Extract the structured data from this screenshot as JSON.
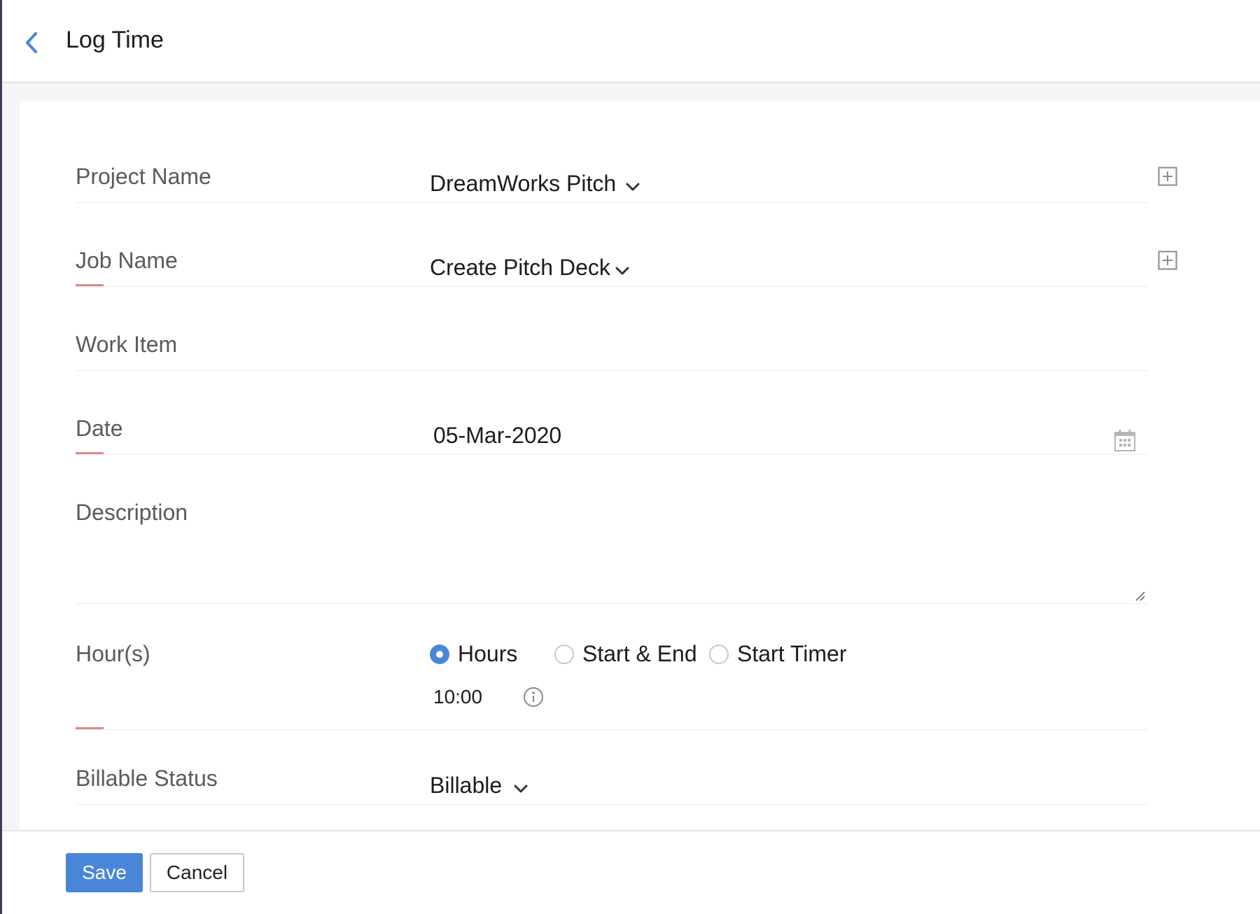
{
  "header": {
    "title": "Log Time",
    "back_icon": "chevron-left-icon"
  },
  "form": {
    "project_name": {
      "label": "Project Name",
      "value": "DreamWorks Pitch",
      "add_icon": "plus-square-icon"
    },
    "job_name": {
      "label": "Job Name",
      "value": "Create Pitch Deck",
      "required": true,
      "add_icon": "plus-square-icon"
    },
    "work_item": {
      "label": "Work Item",
      "value": ""
    },
    "date": {
      "label": "Date",
      "value": "05-Mar-2020",
      "required": true,
      "icon": "calendar-icon"
    },
    "description": {
      "label": "Description",
      "value": ""
    },
    "hours": {
      "label": "Hour(s)",
      "required": true,
      "options": [
        "Hours",
        "Start & End",
        "Start Timer"
      ],
      "selected": "Hours",
      "value": "10:00",
      "info_icon": "info-icon"
    },
    "billable_status": {
      "label": "Billable Status",
      "value": "Billable"
    }
  },
  "footer": {
    "save_label": "Save",
    "cancel_label": "Cancel"
  },
  "colors": {
    "accent": "#4a86d8",
    "required_marker": "#e08a84",
    "sidebar_edge": "#3c3f5a"
  }
}
